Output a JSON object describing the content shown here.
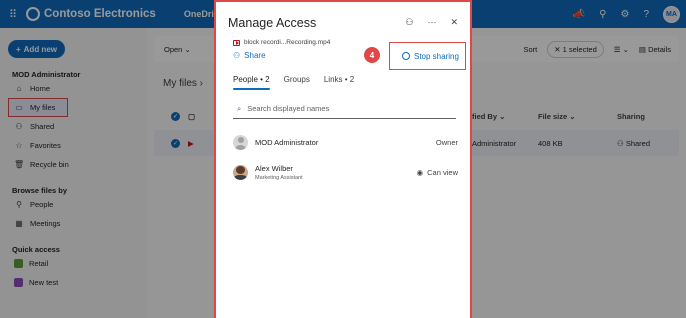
{
  "suite": {
    "brand": "Contoso Electronics",
    "app": "OneDrive",
    "user_initials": "MA",
    "icons": [
      "megaphone-icon",
      "diagram-icon",
      "gear-icon",
      "help-icon"
    ]
  },
  "nav": {
    "new_label": "Add new",
    "user": "MOD Administrator",
    "items": [
      "Home",
      "My files",
      "Shared",
      "Favorites",
      "Recycle bin"
    ],
    "browse_heading": "Browse files by",
    "browse_items": [
      "People",
      "Meetings"
    ],
    "quick_heading": "Quick access",
    "quick_items": [
      "Retail",
      "New test"
    ]
  },
  "toolbar": {
    "open": "Open",
    "sort": "Sort",
    "selected": "1 selected",
    "details": "Details"
  },
  "breadcrumb": "My files",
  "table": {
    "headers": {
      "modified_by": "fied By",
      "size": "File size",
      "sharing": "Sharing"
    },
    "row": {
      "modified_by": "Administrator",
      "size": "408 KB",
      "sharing": "Shared"
    }
  },
  "dialog": {
    "title": "Manage Access",
    "file_name": "block recordi...Recording.mp4",
    "share_label": "Share",
    "stop_sharing": "Stop sharing",
    "step_number": "4",
    "tabs": [
      "People • 2",
      "Groups",
      "Links • 2"
    ],
    "search_placeholder": "Search displayed names",
    "people": [
      {
        "name": "MOD Administrator",
        "subtitle": "",
        "role": "Owner"
      },
      {
        "name": "Alex Wilber",
        "subtitle": "Marketing Assistant",
        "role": "Can view"
      }
    ]
  },
  "colors": {
    "accent": "#0f6cbd",
    "highlight": "#e04848"
  }
}
